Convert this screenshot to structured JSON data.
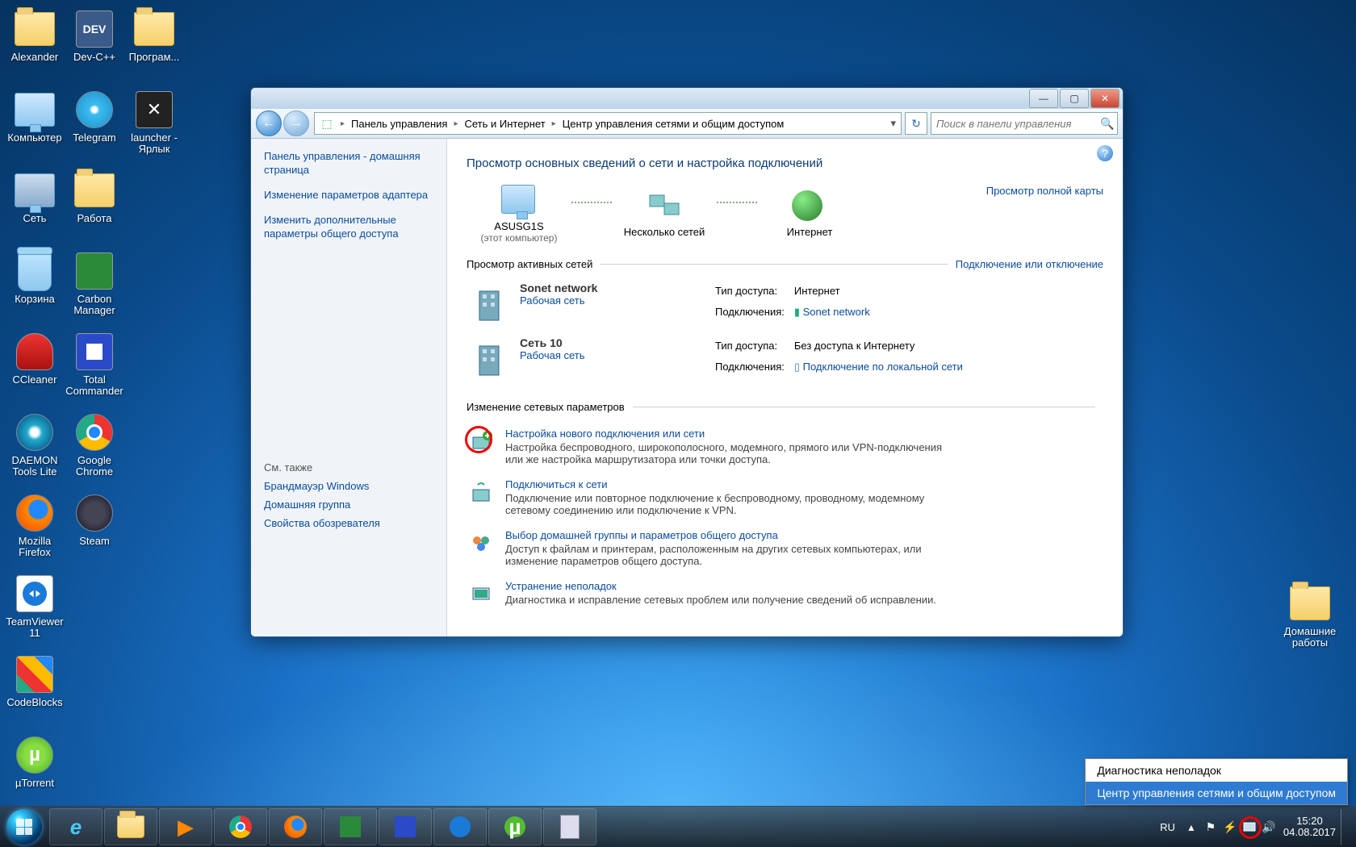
{
  "desktop_icons": {
    "col1": [
      "Alexander",
      "Компьютер",
      "Сеть",
      "Корзина",
      "CCleaner",
      "DAEMON Tools Lite",
      "Mozilla Firefox",
      "TeamViewer 11",
      "CodeBlocks",
      "µTorrent"
    ],
    "col2": [
      "Dev-C++",
      "Telegram",
      "Работа",
      "Carbon Manager",
      "Total Commander",
      "Google Chrome",
      "Steam"
    ],
    "col3": [
      "Програм...",
      "launcher - Ярлык"
    ],
    "right": "Домашние работы"
  },
  "window": {
    "breadcrumbs": [
      "Панель управления",
      "Сеть и Интернет",
      "Центр управления сетями и общим доступом"
    ],
    "search_placeholder": "Поиск в панели управления",
    "sidebar": {
      "links": [
        "Панель управления - домашняя страница",
        "Изменение параметров адаптера",
        "Изменить дополнительные параметры общего доступа"
      ],
      "see_also_header": "См. также",
      "see_also": [
        "Брандмауэр Windows",
        "Домашняя группа",
        "Свойства обозревателя"
      ]
    },
    "main": {
      "title": "Просмотр основных сведений о сети и настройка подключений",
      "map_link": "Просмотр полной карты",
      "nodes": {
        "computer": "ASUSG1S",
        "computer_sub": "(этот компьютер)",
        "networks": "Несколько сетей",
        "internet": "Интернет"
      },
      "active_header": "Просмотр активных сетей",
      "active_link": "Подключение или отключение",
      "net1": {
        "name": "Sonet network",
        "type": "Рабочая сеть",
        "access_label": "Тип доступа:",
        "access": "Интернет",
        "conn_label": "Подключения:",
        "conn": "Sonet network"
      },
      "net2": {
        "name": "Сеть  10",
        "type": "Рабочая сеть",
        "access_label": "Тип доступа:",
        "access": "Без доступа к Интернету",
        "conn_label": "Подключения:",
        "conn": "Подключение по локальной сети"
      },
      "settings_header": "Изменение сетевых параметров",
      "settings": [
        {
          "title": "Настройка нового подключения или сети",
          "desc": "Настройка беспроводного, широкополосного, модемного, прямого или VPN-подключения или же настройка маршрутизатора или точки доступа."
        },
        {
          "title": "Подключиться к сети",
          "desc": "Подключение или повторное подключение к беспроводному, проводному, модемному сетевому соединению или подключение к VPN."
        },
        {
          "title": "Выбор домашней группы и параметров общего доступа",
          "desc": "Доступ к файлам и принтерам, расположенным на других сетевых компьютерах, или изменение параметров общего доступа."
        },
        {
          "title": "Устранение неполадок",
          "desc": "Диагностика и исправление сетевых проблем или получение сведений об исправлении."
        }
      ]
    }
  },
  "netmenu": [
    "Диагностика неполадок",
    "Центр управления сетями и общим доступом"
  ],
  "tray": {
    "lang": "RU",
    "time": "15:20",
    "date": "04.08.2017"
  }
}
